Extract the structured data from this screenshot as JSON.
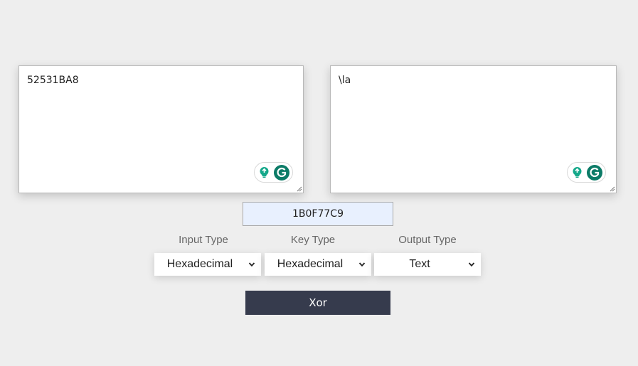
{
  "input_text": {
    "value": "52531BA8"
  },
  "output_text": {
    "value": "\\la"
  },
  "key": {
    "value": "1B0F77C9"
  },
  "controls": {
    "input_type": {
      "label": "Input Type",
      "selected": "Hexadecimal"
    },
    "key_type": {
      "label": "Key Type",
      "selected": "Hexadecimal"
    },
    "output_type": {
      "label": "Output Type",
      "selected": "Text"
    }
  },
  "action": {
    "button_label": "Xor"
  },
  "colors": {
    "page_background": "#eeeeee",
    "button_background": "#363b4d",
    "key_field_background": "#e8f0fe",
    "grammarly_green": "#15a88a",
    "grammarly_dark": "#0c7b67"
  },
  "icons": {
    "textarea_widget": [
      "lightbulb-icon",
      "grammarly-icon"
    ],
    "textarea_corner": "resize-handle-icon",
    "select_arrow": "chevron-down-icon"
  }
}
